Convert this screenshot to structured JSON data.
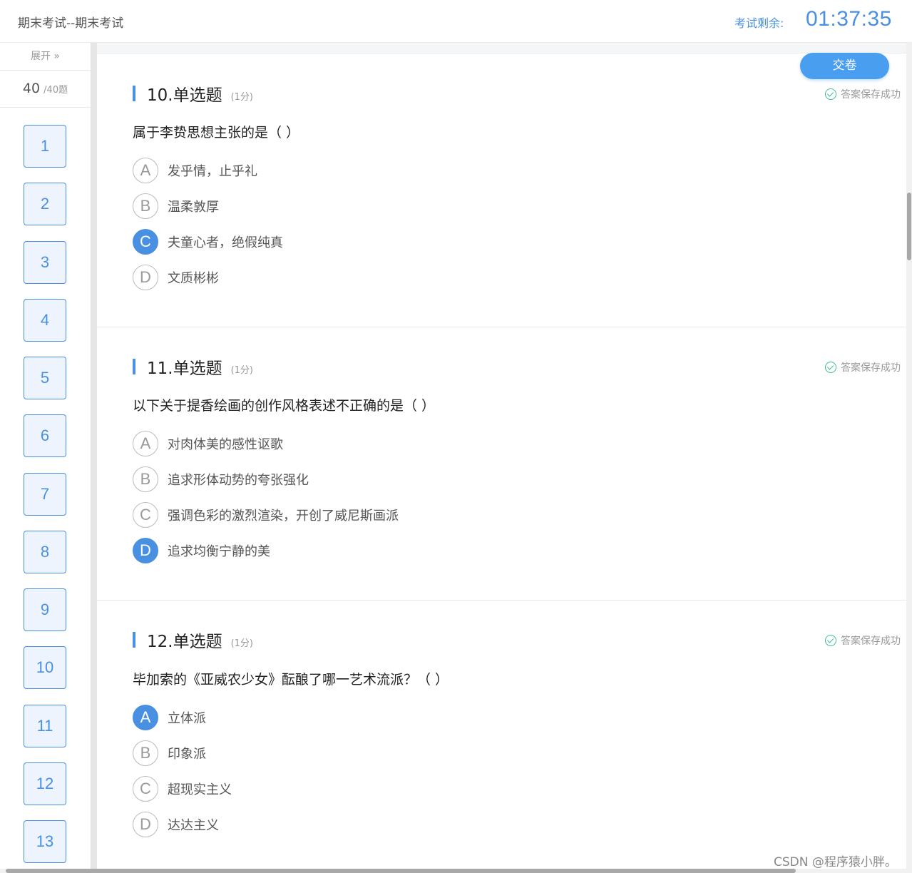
{
  "header": {
    "exam_title": "期末考试--期末考试",
    "timer_label": "考试剩余:",
    "timer": "01:37:35"
  },
  "submit_label": "交卷",
  "sidebar": {
    "expand_label": "展开 »",
    "count": "40",
    "total": "/40题",
    "question_numbers": [
      "1",
      "2",
      "3",
      "4",
      "5",
      "6",
      "7",
      "8",
      "9",
      "10",
      "11",
      "12",
      "13"
    ]
  },
  "questions": [
    {
      "title": "10.单选题",
      "score": "(1分)",
      "saved": "答案保存成功",
      "text": "属于李贽思想主张的是（   ）",
      "options": [
        {
          "letter": "A",
          "text": "发乎情，止乎礼",
          "selected": false
        },
        {
          "letter": "B",
          "text": "温柔敦厚",
          "selected": false
        },
        {
          "letter": "C",
          "text": "夫童心者，绝假纯真",
          "selected": true
        },
        {
          "letter": "D",
          "text": "文质彬彬",
          "selected": false
        }
      ]
    },
    {
      "title": "11.单选题",
      "score": "(1分)",
      "saved": "答案保存成功",
      "text": "以下关于提香绘画的创作风格表述不正确的是（   ）",
      "options": [
        {
          "letter": "A",
          "text": "对肉体美的感性讴歌",
          "selected": false
        },
        {
          "letter": "B",
          "text": "追求形体动势的夸张强化",
          "selected": false
        },
        {
          "letter": "C",
          "text": "强调色彩的激烈渲染，开创了威尼斯画派",
          "selected": false
        },
        {
          "letter": "D",
          "text": "追求均衡宁静的美",
          "selected": true
        }
      ]
    },
    {
      "title": "12.单选题",
      "score": "(1分)",
      "saved": "答案保存成功",
      "text": "毕加索的《亚威农少女》酝酿了哪一艺术流派？（ ）",
      "options": [
        {
          "letter": "A",
          "text": "立体派",
          "selected": true
        },
        {
          "letter": "B",
          "text": "印象派",
          "selected": false
        },
        {
          "letter": "C",
          "text": "超现实主义",
          "selected": false
        },
        {
          "letter": "D",
          "text": "达达主义",
          "selected": false
        }
      ]
    }
  ],
  "watermark": "CSDN @程序猿小胖。",
  "colors": {
    "accent": "#4a90e2",
    "saved": "#3dbf8a"
  }
}
